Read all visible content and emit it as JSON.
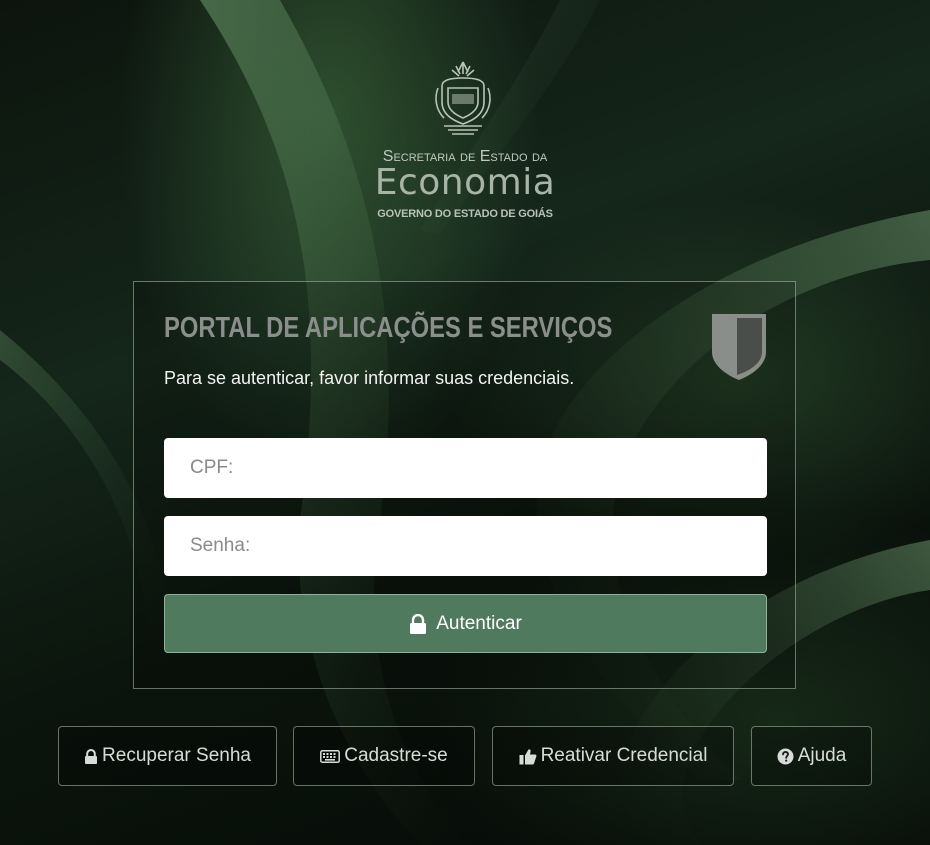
{
  "logo": {
    "line1": "Secretaria de Estado da",
    "line2": "Economia",
    "line3": "GOVERNO DO ESTADO DE GOIÁS",
    "emblem_icon": "state-coat-of-arms-icon"
  },
  "panel": {
    "title": "PORTAL DE APLICAÇÕES E SERVIÇOS",
    "subtitle": "Para se autenticar, favor informar suas credenciais.",
    "shield_icon": "shield-icon",
    "cpf": {
      "placeholder": "CPF:",
      "value": ""
    },
    "senha": {
      "placeholder": "Senha:",
      "value": ""
    },
    "auth_button": {
      "label": "Autenticar",
      "icon": "lock-icon"
    }
  },
  "links": {
    "recuperar": {
      "label": "Recuperar Senha",
      "icon": "lock-icon"
    },
    "cadastre": {
      "label": "Cadastre-se",
      "icon": "keyboard-icon"
    },
    "reativar": {
      "label": "Reativar Credencial",
      "icon": "thumbs-up-icon"
    },
    "ajuda": {
      "label": "Ajuda",
      "icon": "question-circle-icon"
    }
  },
  "colors": {
    "accent_green": "#4f7a5d",
    "background_dark": "#0c140d",
    "title_gray": "#8b8f8b"
  }
}
